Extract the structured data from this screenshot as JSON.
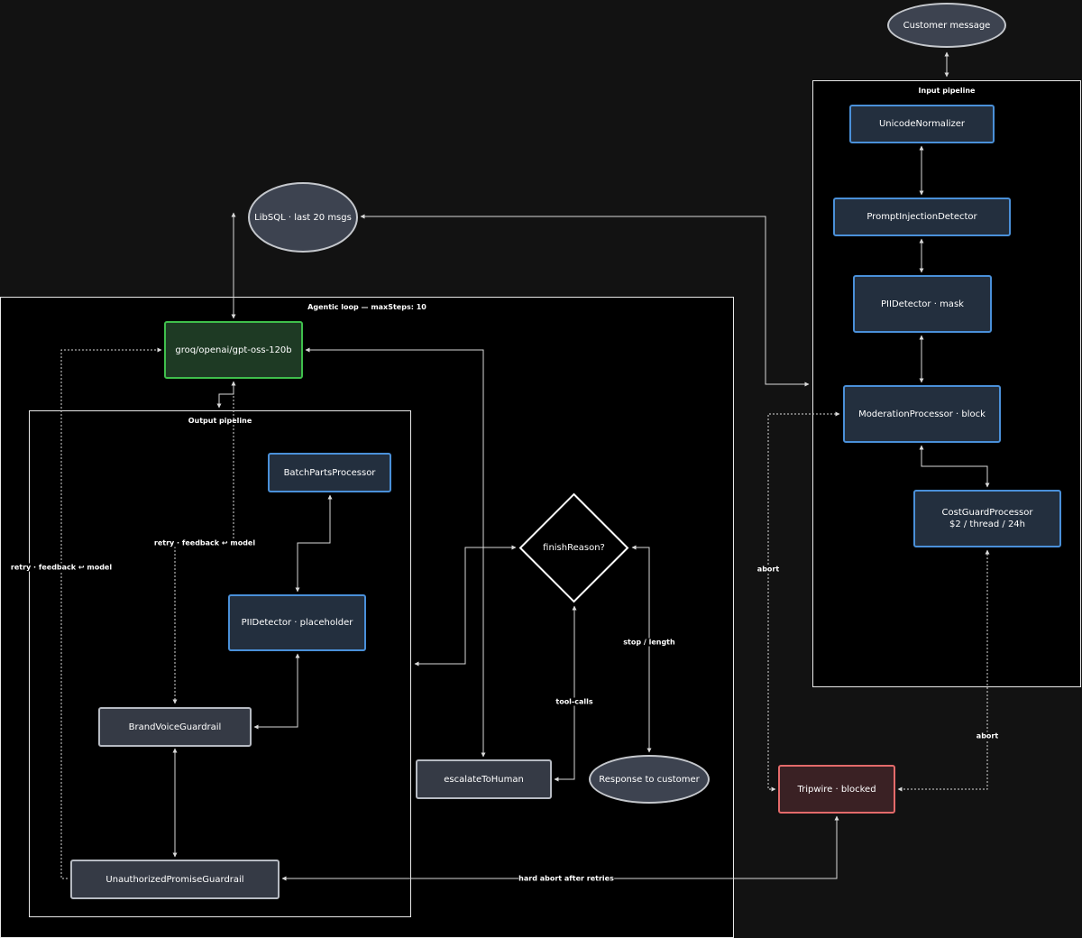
{
  "clusters": {
    "input_pipeline": "Input pipeline",
    "agentic_loop": "Agentic loop — maxSteps: 10",
    "output_pipeline": "Output pipeline"
  },
  "nodes": {
    "customer_message": "Customer message",
    "unicode_normalizer": "UnicodeNormalizer",
    "prompt_injection_detector": "PromptInjectionDetector",
    "pii_detector_mask": "PIIDetector · mask",
    "moderation_processor": "ModerationProcessor · block",
    "cost_guard_processor": "CostGuardProcessor\n$2 / thread / 24h",
    "libsql": "LibSQL · last 20 msgs",
    "model": "groq/openai/gpt-oss-120b",
    "batch_parts_processor": "BatchPartsProcessor",
    "pii_detector_placeholder": "PIIDetector · placeholder",
    "brand_voice_guardrail": "BrandVoiceGuardrail",
    "unauthorized_promise_guardrail": "UnauthorizedPromiseGuardrail",
    "finish_reason": "finishReason?",
    "escalate_to_human": "escalateToHuman",
    "response_to_customer": "Response to customer",
    "tripwire": "Tripwire · blocked"
  },
  "edge_labels": {
    "retry_outer": "retry · feedback ↩ model",
    "retry_inner": "retry · feedback ↩ model",
    "stop_length": "stop / length",
    "tool_calls": "tool-calls",
    "abort_moderation": "abort",
    "abort_cost": "abort",
    "hard_abort": "hard abort after retries"
  },
  "colors": {
    "background": "#121212",
    "cluster_fill": "#000000",
    "edge": "#d9d9d9",
    "processor_border": "#4a90d9",
    "guardrail_border": "#b6bac2",
    "model_border": "#3fbf4c",
    "tripwire_border": "#e46a6a"
  }
}
